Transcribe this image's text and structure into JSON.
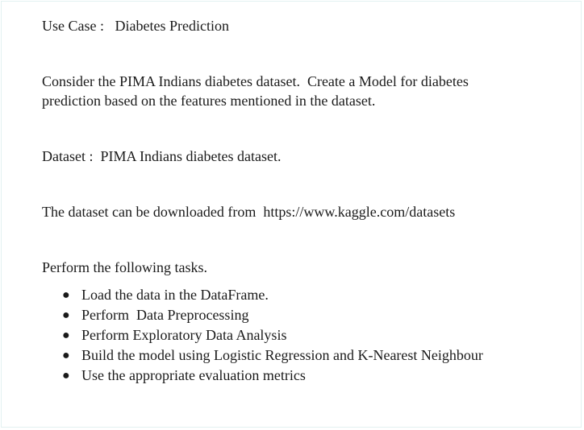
{
  "use_case": {
    "label": "Use Case :",
    "value": "Diabetes Prediction"
  },
  "intro": {
    "line1": "Consider the PIMA Indians diabetes dataset.  Create a Model for diabetes",
    "line2": "prediction based on the features mentioned in the dataset."
  },
  "dataset": {
    "label": "Dataset :",
    "value": "PIMA Indians diabetes dataset."
  },
  "download": {
    "text": "The dataset can be downloaded from",
    "url": "https://www.kaggle.com/datasets"
  },
  "tasks_heading": "Perform the following tasks.",
  "tasks": [
    "Load the data in the DataFrame.",
    "Perform  Data Preprocessing",
    "Perform Exploratory Data Analysis",
    "Build the model using Logistic Regression and K-Nearest Neighbour",
    "Use the appropriate evaluation metrics"
  ]
}
